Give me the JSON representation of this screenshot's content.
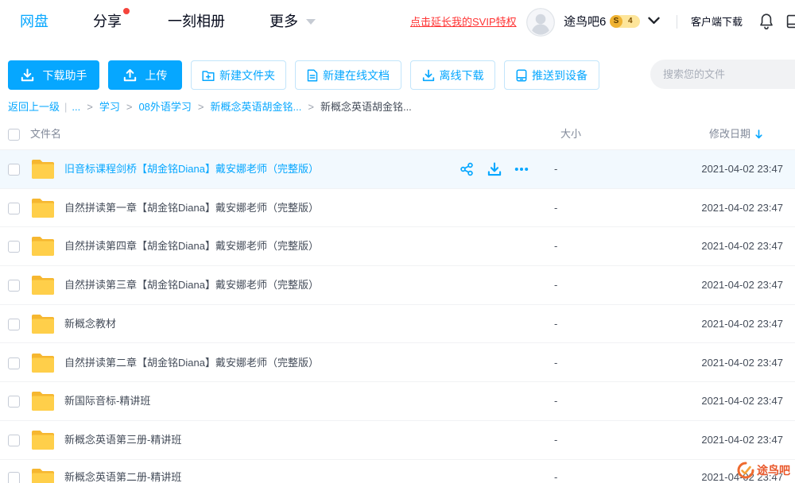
{
  "nav": {
    "tabs": [
      {
        "label": "网盘",
        "active": true
      },
      {
        "label": "分享",
        "badge_dot": true
      },
      {
        "label": "一刻相册"
      },
      {
        "label": "更多",
        "dropdown": true
      }
    ],
    "svip_link": "点击延长我的SVIP特权",
    "username": "途鸟吧6",
    "vip_badge": {
      "letter": "S",
      "level": "4"
    },
    "client_download": "客户端下载",
    "icons": [
      "user-silhouette-icon",
      "chevron-down-icon",
      "bell-icon",
      "window-icon"
    ]
  },
  "toolbar": {
    "buttons": [
      {
        "label": "下载助手",
        "icon": "download-icon",
        "filled": true
      },
      {
        "label": "上传",
        "icon": "upload-icon",
        "filled": true
      },
      {
        "label": "新建文件夹",
        "icon": "new-folder-icon",
        "filled": false
      },
      {
        "label": "新建在线文档",
        "icon": "document-icon",
        "filled": false
      },
      {
        "label": "离线下载",
        "icon": "download-icon",
        "filled": false
      },
      {
        "label": "推送到设备",
        "icon": "device-icon",
        "filled": false
      }
    ],
    "search": {
      "placeholder": "搜索您的文件",
      "icon": "search-field"
    }
  },
  "breadcrumb": {
    "back": "返回上一级",
    "divider": "|",
    "separator": ">",
    "items": [
      {
        "label": "..."
      },
      {
        "label": "学习"
      },
      {
        "label": "08外语学习"
      },
      {
        "label": "新概念英语胡金铭..."
      },
      {
        "label": "新概念英语胡金铭...",
        "current": true
      }
    ]
  },
  "file_list": {
    "columns": {
      "name": "文件名",
      "size": "大小",
      "modified": "修改日期",
      "sort_icon": "sort-down-icon"
    },
    "row_actions": [
      "share-icon",
      "download-icon",
      "more-icon"
    ],
    "rows": [
      {
        "name": "旧音标课程剑桥【胡金铭Diana】戴安娜老师（完整版）",
        "size": "-",
        "modified": "2021-04-02 23:47",
        "icon": "folder-icon",
        "hovered": true
      },
      {
        "name": "自然拼读第一章【胡金铭Diana】戴安娜老师（完整版）",
        "size": "-",
        "modified": "2021-04-02 23:47",
        "icon": "folder-icon"
      },
      {
        "name": "自然拼读第四章【胡金铭Diana】戴安娜老师（完整版）",
        "size": "-",
        "modified": "2021-04-02 23:47",
        "icon": "folder-icon"
      },
      {
        "name": "自然拼读第三章【胡金铭Diana】戴安娜老师（完整版）",
        "size": "-",
        "modified": "2021-04-02 23:47",
        "icon": "folder-icon"
      },
      {
        "name": "新概念教材",
        "size": "-",
        "modified": "2021-04-02 23:47",
        "icon": "folder-icon"
      },
      {
        "name": "自然拼读第二章【胡金铭Diana】戴安娜老师（完整版）",
        "size": "-",
        "modified": "2021-04-02 23:47",
        "icon": "folder-icon"
      },
      {
        "name": "新国际音标-精讲班",
        "size": "-",
        "modified": "2021-04-02 23:47",
        "icon": "folder-icon"
      },
      {
        "name": "新概念英语第三册-精讲班",
        "size": "-",
        "modified": "2021-04-02 23:47",
        "icon": "folder-icon"
      },
      {
        "name": "新概念英语第二册-精讲班",
        "size": "-",
        "modified": "2021-04-02 23:47",
        "icon": "folder-icon"
      }
    ]
  },
  "watermark": {
    "text": "途鸟吧"
  },
  "colors": {
    "accent": "#06a7ff",
    "svip_link": "#ff3333",
    "notification_dot": "#f5443b",
    "folder": "#ffcf4a",
    "row_hover": "#f2f9fe",
    "text": "#454d5a",
    "muted": "#818999"
  }
}
